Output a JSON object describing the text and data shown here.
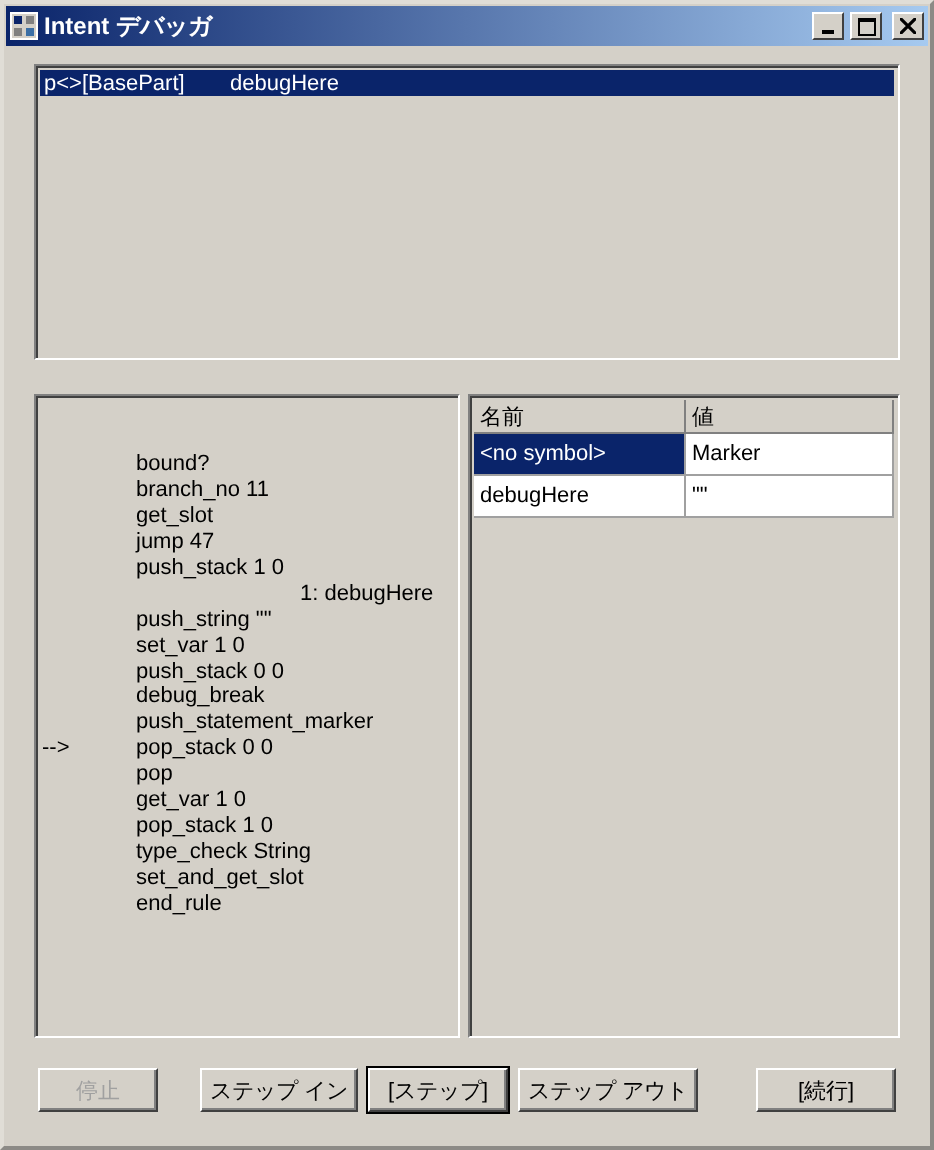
{
  "window": {
    "title": "Intent デバッガ"
  },
  "call_stack": {
    "rows": [
      {
        "part": "p<>[BasePart]",
        "rule": "debugHere",
        "selected": true
      }
    ]
  },
  "code": {
    "lines": [
      {
        "text": "bound?"
      },
      {
        "text": "branch_no 11"
      },
      {
        "text": "get_slot"
      },
      {
        "text": "jump 47"
      },
      {
        "text": "push_stack 1 0",
        "children": [
          {
            "text": "1: debugHere"
          }
        ]
      },
      {
        "text": "push_string \"\""
      },
      {
        "text": "set_var 1 0"
      },
      {
        "text": "push_stack 0 0"
      },
      {
        "text": "debug_break"
      },
      {
        "text": "push_statement_marker"
      },
      {
        "text": "pop_stack 0 0",
        "marker": "-->"
      },
      {
        "text": "pop"
      },
      {
        "text": "get_var 1 0"
      },
      {
        "text": "pop_stack 1 0"
      },
      {
        "text": "type_check String"
      },
      {
        "text": "set_and_get_slot"
      },
      {
        "text": "end_rule"
      }
    ]
  },
  "variables": {
    "columns": [
      "名前",
      "値"
    ],
    "rows": [
      {
        "name": "<no symbol>",
        "value": "Marker",
        "selected": true
      },
      {
        "name": "debugHere",
        "value": "\"\"",
        "selected": false
      }
    ]
  },
  "buttons": [
    {
      "label": "停止",
      "disabled": true,
      "default": false
    },
    {
      "label": "ステップ イン",
      "disabled": false,
      "default": false
    },
    {
      "label": "[ステップ]",
      "disabled": false,
      "default": true
    },
    {
      "label": "ステップ アウト",
      "disabled": false,
      "default": false
    },
    {
      "label": "[続行]",
      "disabled": false,
      "default": false
    }
  ]
}
